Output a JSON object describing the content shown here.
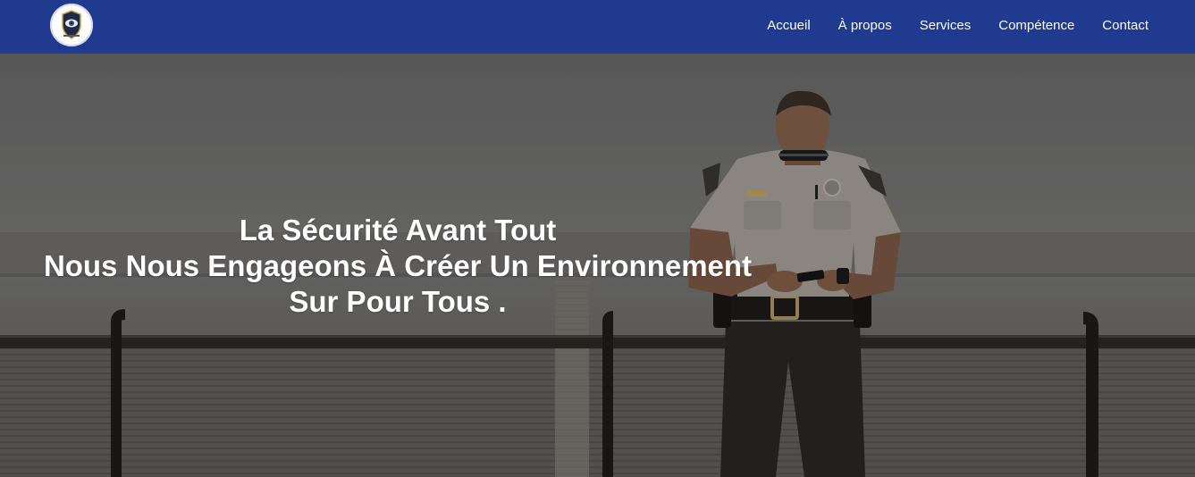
{
  "header": {
    "logo_icon": "shield-eye-logo",
    "nav": [
      {
        "label": "Accueil"
      },
      {
        "label": "À propos"
      },
      {
        "label": "Services"
      },
      {
        "label": "Compétence"
      },
      {
        "label": "Contact"
      }
    ],
    "background_color": "#1f3a8f"
  },
  "hero": {
    "line1": "La Sécurité Avant Tout",
    "line2": "Nous Nous Engageons À Créer Un Environnement",
    "line3": "Sur Pour Tous .",
    "image": "security-guard-photo"
  }
}
